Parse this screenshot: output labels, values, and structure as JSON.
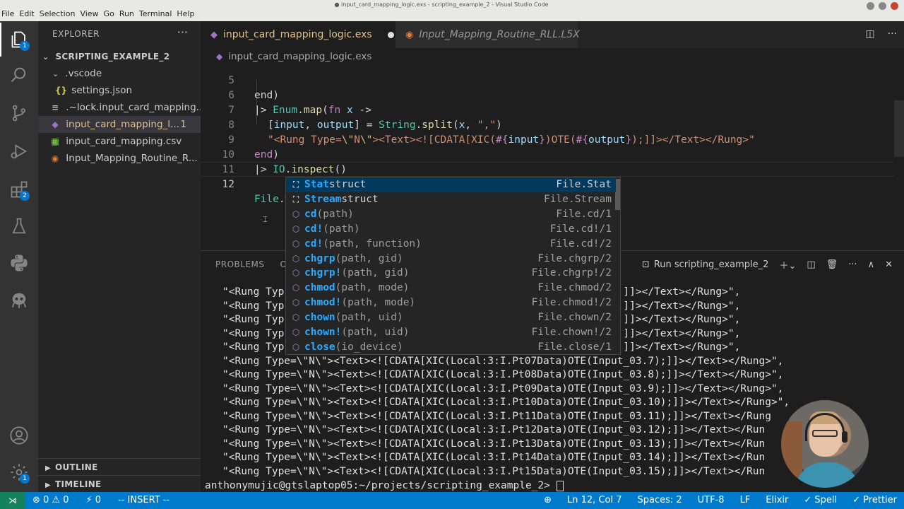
{
  "window": {
    "title": "● input_card_mapping_logic.exs - scripting_example_2 - Visual Studio Code",
    "menus": [
      "File",
      "Edit",
      "Selection",
      "View",
      "Go",
      "Run",
      "Terminal",
      "Help"
    ]
  },
  "activity_bar": {
    "explorer_badge": "1",
    "extensions_badge": "2",
    "settings_badge": "1"
  },
  "sidebar": {
    "title": "EXPLORER",
    "more": "···",
    "workspace": "SCRIPTING_EXAMPLE_2",
    "items": [
      {
        "label": ".vscode",
        "icon": "chevron-down"
      },
      {
        "label": "settings.json",
        "icon": "{}"
      },
      {
        "label": ".~lock.input_card_mapping...",
        "icon": "≡"
      },
      {
        "label": "input_card_mapping_l...",
        "icon": "elixir-icon",
        "count": "1"
      },
      {
        "label": "input_card_mapping.csv",
        "icon": "csv-icon"
      },
      {
        "label": "Input_Mapping_Routine_R...",
        "icon": "rss-icon"
      }
    ],
    "outline": "OUTLINE",
    "timeline": "TIMELINE"
  },
  "tabs": [
    {
      "label": "input_card_mapping_logic.exs",
      "state": "active-modified"
    },
    {
      "label": "Input_Mapping_Routine_RLL.L5X",
      "state": "preview"
    }
  ],
  "breadcrumb": "input_card_mapping_logic.exs",
  "editor": {
    "lines": [
      {
        "n": "5",
        "text": "end)"
      },
      {
        "n": "6",
        "text": "|> Enum.map(fn x ->"
      },
      {
        "n": "7",
        "text": "[input, output] = String.split(x, \",\")"
      },
      {
        "n": "8",
        "text": "\"<Rung Type=\\\"N\\\"><Text><![CDATA[XIC(#{input})OTE(#{output});]]></Text></Rung>\""
      },
      {
        "n": "9",
        "text": "end)"
      },
      {
        "n": "10",
        "text": "|> IO.inspect()"
      },
      {
        "n": "11",
        "text": ""
      },
      {
        "n": "12",
        "text": "File.w"
      }
    ]
  },
  "suggest": [
    {
      "match": "Stat",
      "rest": "struct",
      "sig": "",
      "detail": "File.Stat",
      "kind": "struct"
    },
    {
      "match": "Stream",
      "rest": "struct",
      "sig": "",
      "detail": "File.Stream",
      "kind": "struct"
    },
    {
      "match": "cd",
      "rest": "",
      "sig": "(path)",
      "detail": "File.cd/1",
      "kind": "method"
    },
    {
      "match": "cd!",
      "rest": "",
      "sig": "(path)",
      "detail": "File.cd!/1",
      "kind": "method"
    },
    {
      "match": "cd!",
      "rest": "",
      "sig": "(path, function)",
      "detail": "File.cd!/2",
      "kind": "method"
    },
    {
      "match": "chgrp",
      "rest": "",
      "sig": "(path, gid)",
      "detail": "File.chgrp/2",
      "kind": "method"
    },
    {
      "match": "chgrp!",
      "rest": "",
      "sig": "(path, gid)",
      "detail": "File.chgrp!/2",
      "kind": "method"
    },
    {
      "match": "chmod",
      "rest": "",
      "sig": "(path, mode)",
      "detail": "File.chmod/2",
      "kind": "method"
    },
    {
      "match": "chmod!",
      "rest": "",
      "sig": "(path, mode)",
      "detail": "File.chmod!/2",
      "kind": "method"
    },
    {
      "match": "chown",
      "rest": "",
      "sig": "(path, uid)",
      "detail": "File.chown/2",
      "kind": "method"
    },
    {
      "match": "chown!",
      "rest": "",
      "sig": "(path, uid)",
      "detail": "File.chown!/2",
      "kind": "method"
    },
    {
      "match": "close",
      "rest": "",
      "sig": "(io_device)",
      "detail": "File.close/1",
      "kind": "method"
    }
  ],
  "panel": {
    "tabs": [
      "PROBLEMS",
      "OU"
    ],
    "terminal_name": "Run scripting_example_2",
    "lines": [
      "\"<Rung Typ                                            nput_03.2);]]></Text></Rung>\",",
      "\"<Rung Typ                                            nput_03.3);]]></Text></Rung>\",",
      "\"<Rung Typ                                            nput_03.4);]]></Text></Rung>\",",
      "\"<Rung Typ                                            nput_03.5);]]></Text></Rung>\",",
      "\"<Rung Typ                                            nput_03.6);]]></Text></Rung>\",",
      "\"<Rung Type=\\\"N\\\"><Text><![CDATA[XIC(Local:3:I.Pt07Data)OTE(Input_03.7);]]></Text></Rung>\",",
      "\"<Rung Type=\\\"N\\\"><Text><![CDATA[XIC(Local:3:I.Pt08Data)OTE(Input_03.8);]]></Text></Rung>\",",
      "\"<Rung Type=\\\"N\\\"><Text><![CDATA[XIC(Local:3:I.Pt09Data)OTE(Input_03.9);]]></Text></Rung>\",",
      "\"<Rung Type=\\\"N\\\"><Text><![CDATA[XIC(Local:3:I.Pt10Data)OTE(Input_03.10);]]></Text></Rung>\",",
      "\"<Rung Type=\\\"N\\\"><Text><![CDATA[XIC(Local:3:I.Pt11Data)OTE(Input_03.11);]]></Text></Rung",
      "\"<Rung Type=\\\"N\\\"><Text><![CDATA[XIC(Local:3:I.Pt12Data)OTE(Input_03.12);]]></Text></Run",
      "\"<Rung Type=\\\"N\\\"><Text><![CDATA[XIC(Local:3:I.Pt13Data)OTE(Input_03.13);]]></Text></Run",
      "\"<Rung Type=\\\"N\\\"><Text><![CDATA[XIC(Local:3:I.Pt14Data)OTE(Input_03.14);]]></Text></Run",
      "\"<Rung Type=\\\"N\\\"><Text><![CDATA[XIC(Local:3:I.Pt15Data)OTE(Input_03.15);]]></Text></Run"
    ],
    "prompt": "anthonymujic@gtslaptop05:~/projects/scripting_example_2> "
  },
  "statusbar": {
    "errors": "⊗ 0 ⚠ 0",
    "ports": "⚡ 0",
    "mode": "-- INSERT --",
    "position": "Ln 12, Col 7",
    "spaces": "Spaces: 2",
    "encoding": "UTF-8",
    "eol": "LF",
    "language": "Elixir",
    "spell": "✓ Spell",
    "prettier": "✓ Prettier"
  },
  "colors": {
    "activity_bar": "#333333",
    "sidebar": "#252526",
    "editor": "#1e1e1e",
    "statusbar": "#007acc",
    "modified": "#e2c08d"
  }
}
